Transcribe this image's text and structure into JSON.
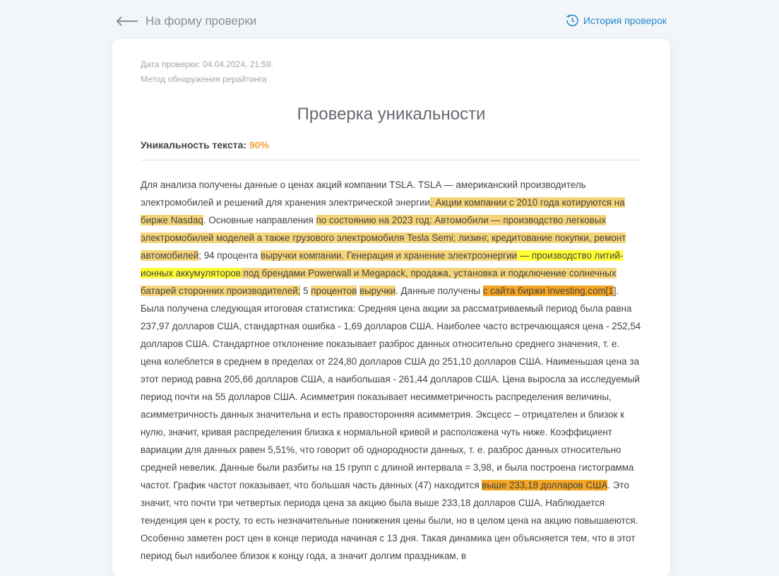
{
  "nav": {
    "back_label": "На форму проверки",
    "history_label": "История проверок"
  },
  "report": {
    "date_line": "Дата проверки: 04.04.2024, 21:59.",
    "method_line": "Метод обнаружения рерайтинга",
    "title": "Проверка уникальности",
    "uniqueness_label": "Уникальность текста: ",
    "uniqueness_value": "90%"
  },
  "colors": {
    "accent_blue": "#1f87c9",
    "uniqueness_orange": "#f0a43a",
    "highlight_light": "#f6d57a",
    "highlight_yellow": "#ffff33",
    "highlight_orange": "#f5a623"
  },
  "segments": [
    {
      "t": "Для анализа получены данные о ценах акций компании TSLA. TSLA — американский производитель электромобилей и решений для хранения электрической энергии",
      "h": ""
    },
    {
      "t": ". Акции компании с 2010 года котируются на бирже Nasdaq",
      "h": "light"
    },
    {
      "t": ". Основные направления ",
      "h": ""
    },
    {
      "t": "по состоянию на 2023 год: Автомобили — производство легковых электромобилей моделей а также грузового электромобиля Tesla Semi; лизинг, кредитование покупки, ремонт автомобилей",
      "h": "light"
    },
    {
      "t": "; 94 процента ",
      "h": ""
    },
    {
      "t": "выручки компании. Генерация и хранение электроэнергии",
      "h": "light"
    },
    {
      "t": " — производство литий-ионных аккумуляторов",
      "h": "yellow"
    },
    {
      "t": " под брендами Powerwall и Megapack, продажа, установка и подключение солнечных батарей сторонних производителей;",
      "h": "light"
    },
    {
      "t": " 5 ",
      "h": ""
    },
    {
      "t": "процентов",
      "h": "light"
    },
    {
      "t": " ",
      "h": ""
    },
    {
      "t": "выручки",
      "h": "light"
    },
    {
      "t": ". Данные получены ",
      "h": ""
    },
    {
      "t": "с сайта биржи investing.com[1",
      "h": "orange"
    },
    {
      "t": "]. Была получена следующая итоговая статистика: Средняя цена акции за рассматриваемый период была равна 237,97 долларов США, стандартная ошибка - 1,69 долларов США. Наиболее часто встречающаяся цена - 252,54 долларов США. Стандартное отклонение показывает разброс данных относительно среднего значения, т. е. цена колеблется в среднем в пределах от 224,80 долларов США до 251,10 долларов США. Наименьшая цена за этот период равна 205,66 долларов США, а наибольшая - 261,44 долларов США. Цена выросла за исследуемый период почти на 55 долларов США. Асимметрия показывает несимметричность распределения величины, асимметричность данных значительна и есть правосторонняя асимметрия. Эксцесс – отрицателен и близок к нулю, значит, кривая распределения близка к нормальной кривой и расположена чуть ниже. Коэффициент вариации для данных равен 5,51%, что говорит об однородности данных, т. е. разброс данных относительно средней невелик. Данные были разбиты на 15 групп с длиной интервала = 3,98, и была построена гистограмма частот. График частот показывает, что большая часть данных (47) находится ",
      "h": ""
    },
    {
      "t": "выше 233,18 долларов США",
      "h": "orange"
    },
    {
      "t": ". Это значит, что почти три четвертых периода цена за акцию была выше 233,18 долларов США. Наблюдается тенденция цен к росту, то есть незначительные понижения цены были, но в целом цена на акцию повышаеются. Особенно заметен рост цен в конце периода начиная с 13 дня. Такая динамика цен объясняется тем, что в этот период был наиболее близок к концу года, а значит долгим праздникам, в",
      "h": ""
    }
  ]
}
